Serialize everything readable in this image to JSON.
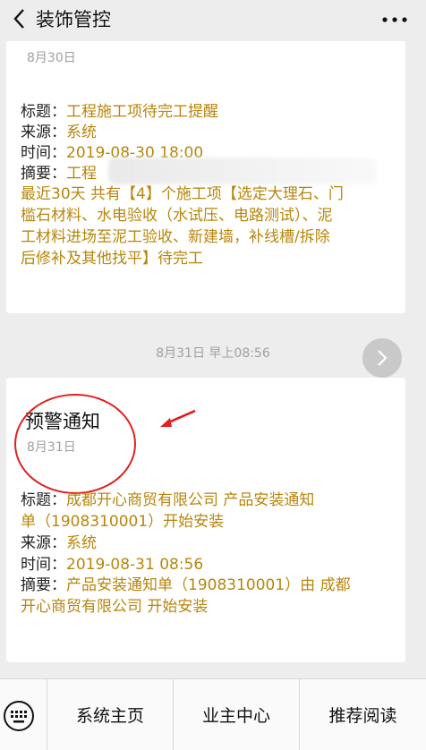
{
  "header": {
    "title": "装饰管控"
  },
  "card1": {
    "date": "8月30日",
    "title_label": "标题：",
    "title_value": "工程施工项待完工提醒",
    "source_label": "来源：",
    "source_value": "系统",
    "time_label": "时间：",
    "time_value": "2019-08-30 18:00",
    "summary_label": "摘要：",
    "summary_value_start": "工程",
    "summary_lines": [
      "最近30天 共有【4】个施工项【选定大理石、门",
      "槛石材料、水电验收（水试压、电路测试）、泥",
      "工材料进场至泥工验收、新建墙，补线槽/拆除",
      "后修补及其他找平】待完工"
    ]
  },
  "timestamp": "8月31日 早上08:56",
  "card2": {
    "heading": "预警通知",
    "date": "8月31日",
    "title_label": "标题：",
    "title_value_line1": "成都开心商贸有限公司 产品安装通知",
    "title_value_line2": "单（1908310001）开始安装",
    "source_label": "来源：",
    "source_value": "系统",
    "time_label": "时间：",
    "time_value": "2019-08-31 08:56",
    "summary_label": "摘要：",
    "summary_value_line1": "产品安装通知单（1908310001）由 成都",
    "summary_value_line2": "开心商贸有限公司 开始安装"
  },
  "bottom_menu": {
    "items": [
      "系统主页",
      "业主中心",
      "推荐阅读"
    ]
  },
  "colors": {
    "accent": "#b8860b",
    "annotation": "#e1201f"
  },
  "icons": [
    "back-icon",
    "more-icon",
    "share-arrow-icon",
    "keyboard-icon"
  ]
}
